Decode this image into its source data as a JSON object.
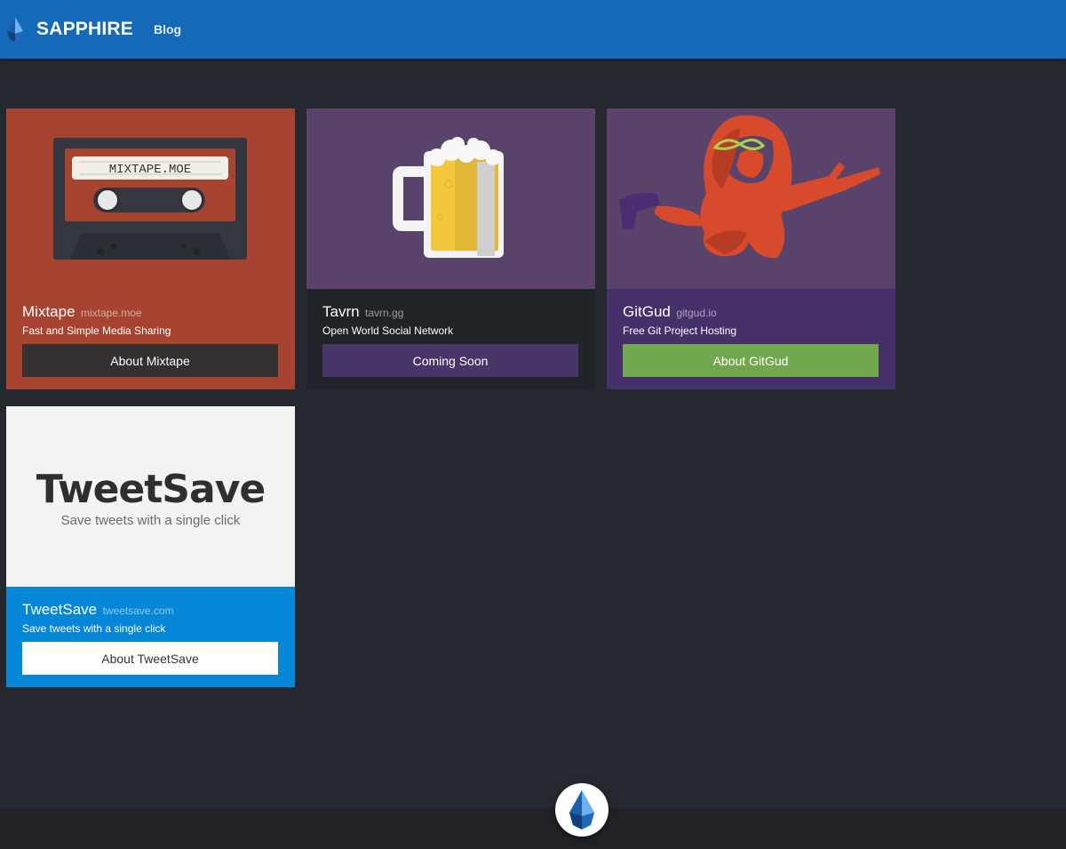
{
  "header": {
    "brand": "SAPPHIRE",
    "nav": [
      "Blog"
    ],
    "color": "#1469b8"
  },
  "cards": [
    {
      "title": "Mixtape",
      "domain": "mixtape.moe",
      "description": "Fast and Simple Media Sharing",
      "button": "About Mixtape",
      "label_text": "MIXTAPE.MOE",
      "image_bg": "#a64331",
      "body_bg": "#a64331",
      "button_bg": "#34302f"
    },
    {
      "title": "Tavrn",
      "domain": "tavrn.gg",
      "description": "Open World Social Network",
      "button": "Coming Soon",
      "image_bg": "#5a436b",
      "body_bg": "#202328",
      "button_bg": "#473667"
    },
    {
      "title": "GitGud",
      "domain": "gitgud.io",
      "description": "Free Git Project Hosting",
      "button": "About GitGud",
      "image_bg": "#5a436b",
      "body_bg": "#45306a",
      "button_bg": "#72a84d"
    },
    {
      "title": "TweetSave",
      "domain": "tweetsave.com",
      "description": "Save tweets with a single click",
      "button": "About TweetSave",
      "logo_text": "TweetSave",
      "logo_tagline": "Save tweets with a single click",
      "image_bg": "#f3f3f3",
      "body_bg": "#0586d6",
      "button_bg": "#ffffff"
    }
  ],
  "icons": [
    "sapphire-gem-icon",
    "cassette-icon",
    "beer-mug-icon",
    "gitgud-girl-illustration"
  ]
}
